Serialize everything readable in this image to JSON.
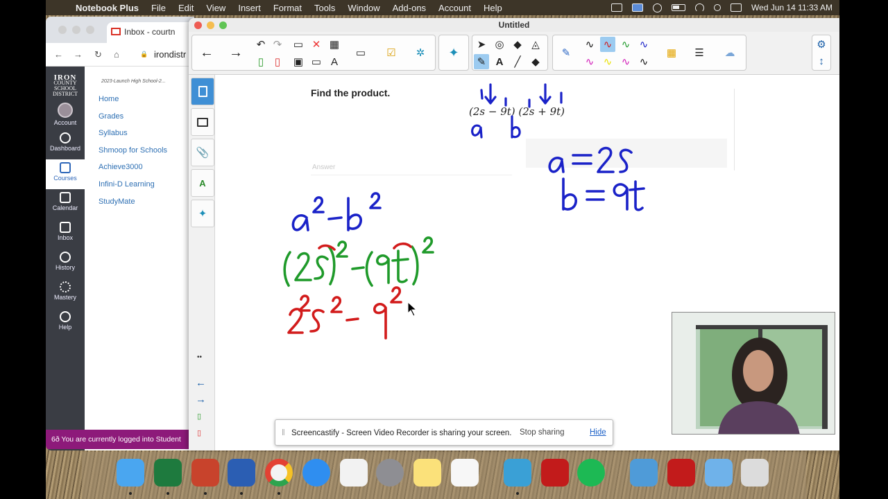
{
  "menubar": {
    "app_name": "Notebook Plus",
    "items": [
      "File",
      "Edit",
      "View",
      "Insert",
      "Format",
      "Tools",
      "Window",
      "Add-ons",
      "Account",
      "Help"
    ],
    "clock": "Wed Jun 14  11:33 AM"
  },
  "browser": {
    "tab_title": "Inbox - courtn",
    "address": "irondistr",
    "logo_lines": [
      "IRON",
      "COUNTY SCHOOL",
      "DISTRICT"
    ],
    "global_nav": [
      {
        "label": "Account",
        "icon": "account-avatar-icon"
      },
      {
        "label": "Dashboard",
        "icon": "dashboard-icon"
      },
      {
        "label": "Courses",
        "icon": "courses-icon",
        "active": true
      },
      {
        "label": "Calendar",
        "icon": "calendar-icon"
      },
      {
        "label": "Inbox",
        "icon": "inbox-icon"
      },
      {
        "label": "History",
        "icon": "history-icon"
      },
      {
        "label": "Mastery",
        "icon": "mastery-icon"
      },
      {
        "label": "Help",
        "icon": "help-icon"
      }
    ],
    "course_crumb": "2023-Launch High School-2...",
    "course_nav": [
      "Home",
      "Grades",
      "Syllabus",
      "Shmoop for Schools",
      "Achieve3000",
      "Infini-D Learning",
      "StudyMate"
    ],
    "logged_in_banner": "You are currently logged into Student"
  },
  "notebook": {
    "window_title": "Untitled",
    "question": "Find the product.",
    "expression": "(2s − 9t) (2s + 9t)",
    "answer_label": "Answer",
    "ink_notes": {
      "labels_under_expr": [
        "a",
        "b"
      ],
      "definitions": [
        "a = 2s",
        "b = 9t"
      ],
      "formula": "a² − b²",
      "substitution": "(2s)² − (9t)²",
      "expansion": "2²s² − 9²"
    }
  },
  "screencastify": {
    "message": "Screencastify - Screen Video Recorder is sharing your screen.",
    "stop_label": "Stop sharing",
    "hide_label": "Hide"
  },
  "colors": {
    "ink_blue": "#1a22c8",
    "ink_green": "#1f9a2a",
    "ink_red": "#d21b1b",
    "canvas_nav": "#3a3d44",
    "selected_tab": "#3f8fd5"
  }
}
